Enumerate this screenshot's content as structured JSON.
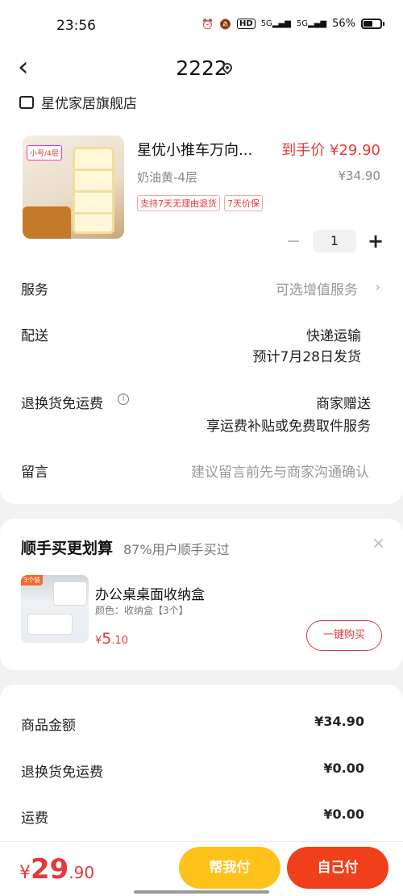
{
  "status_bar": {
    "time": "23:56",
    "icons": [
      "alarm-icon",
      "mute-icon",
      "hd-icon",
      "5g-signal-icon",
      "5g-signal-icon",
      "battery-icon"
    ],
    "network1": "5G",
    "network2": "5G",
    "hd": "HD",
    "battery": "56%"
  },
  "header": {
    "title": "2222"
  },
  "store": {
    "name": "星优家居旗舰店"
  },
  "product": {
    "name": "星优小推车万向...",
    "final_price": "到手价 ¥29.90",
    "spec": "奶油黄-4层",
    "original_price": "¥34.90",
    "tags": [
      "支持7天无理由退货",
      "7天价保"
    ],
    "image_badge": "小号/4层",
    "quantity": "1",
    "minus": "−",
    "plus": "+"
  },
  "rows": {
    "service": {
      "label": "服务",
      "value": "可选增值服务"
    },
    "delivery": {
      "label": "配送",
      "value1": "快递运输",
      "value2": "预计7月28日发货"
    },
    "return": {
      "label": "退换货免运费",
      "value1": "商家赠送",
      "value2": "享运费补贴或免费取件服务"
    },
    "message": {
      "label": "留言",
      "placeholder": "建议留言前先与商家沟通确认"
    }
  },
  "recommend": {
    "title": "顺手买更划算",
    "subtitle": "87%用户顺手买过",
    "close": "×",
    "item_label": "3个装",
    "item_name": "办公桌桌面收纳盒",
    "item_spec": "颜色：收纳盒【3个】",
    "price_symbol": "¥",
    "price_int": "5",
    "price_dec": ".10",
    "buy_button": "一键购买"
  },
  "summary": {
    "goods_amount": {
      "label": "商品金额",
      "value": "¥34.90"
    },
    "return_shipping": {
      "label": "退换货免运费",
      "value": "¥0.00"
    },
    "shipping": {
      "label": "运费",
      "value": "¥0.00"
    }
  },
  "bottom": {
    "currency": "¥",
    "total_int": "29",
    "total_dec": ".90",
    "help_pay": "帮我付",
    "self_pay": "自己付"
  },
  "colors": {
    "accent": "#e4393c",
    "help_button": "#ffc21a",
    "pay_button": "#f0401b"
  }
}
